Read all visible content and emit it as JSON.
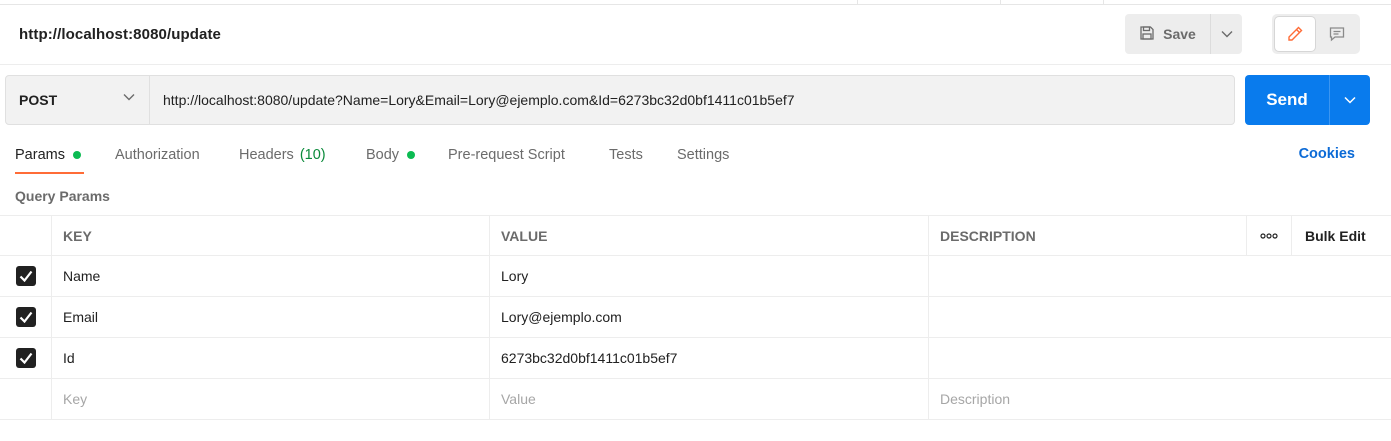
{
  "request": {
    "title": "http://localhost:8080/update",
    "method": "POST",
    "url": "http://localhost:8080/update?Name=Lory&Email=Lory@ejemplo.com&Id=6273bc32d0bf1411c01b5ef7"
  },
  "header": {
    "save_label": "Save",
    "save_icon": "floppy-disk-icon",
    "edit_icon": "pencil-icon",
    "comment_icon": "comment-icon"
  },
  "send": {
    "label": "Send",
    "color": "#097bed"
  },
  "tabs": [
    {
      "label": "Params",
      "active": true,
      "dot": true
    },
    {
      "label": "Authorization"
    },
    {
      "label": "Headers",
      "count": "(10)"
    },
    {
      "label": "Body",
      "dot": true
    },
    {
      "label": "Pre-request Script"
    },
    {
      "label": "Tests"
    },
    {
      "label": "Settings"
    }
  ],
  "cookies_label": "Cookies",
  "query_params": {
    "title": "Query Params",
    "columns": {
      "key": "KEY",
      "value": "VALUE",
      "description": "DESCRIPTION",
      "more": "ooo",
      "bulk_edit": "Bulk Edit"
    },
    "rows": [
      {
        "key": "Name",
        "value": "Lory",
        "description": "",
        "checked": true
      },
      {
        "key": "Email",
        "value": "Lory@ejemplo.com",
        "description": "",
        "checked": true
      },
      {
        "key": "Id",
        "value": "6273bc32d0bf1411c01b5ef7",
        "description": "",
        "checked": true
      }
    ],
    "placeholders": {
      "key": "Key",
      "value": "Value",
      "description": "Description"
    }
  },
  "colors": {
    "accent_underline": "#ff6c37",
    "status_dot": "#0cbb52",
    "link": "#0b6ad6"
  }
}
